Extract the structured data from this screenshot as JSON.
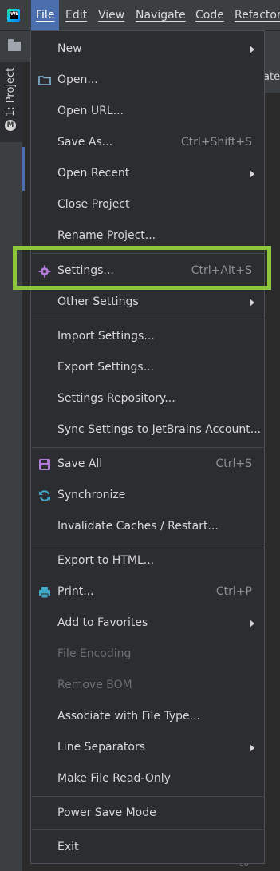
{
  "app": {
    "logo_text": "WS"
  },
  "menubar": {
    "file": "File",
    "edit": "Edit",
    "view": "View",
    "navigate": "Navigate",
    "code": "Code",
    "refactor": "Refactor"
  },
  "toolwindow": {
    "project_label": "1: Project",
    "maven_glyph": "M"
  },
  "background": {
    "tab_text": "ate",
    "line_number": "86"
  },
  "file_menu": {
    "new": "New",
    "open": "Open...",
    "open_url": "Open URL...",
    "save_as": "Save As...",
    "save_as_shortcut": "Ctrl+Shift+S",
    "open_recent": "Open Recent",
    "close_project": "Close Project",
    "rename_project": "Rename Project...",
    "settings": "Settings...",
    "settings_shortcut": "Ctrl+Alt+S",
    "other_settings": "Other Settings",
    "import_settings": "Import Settings...",
    "export_settings": "Export Settings...",
    "settings_repository": "Settings Repository...",
    "sync_settings": "Sync Settings to JetBrains Account...",
    "save_all": "Save All",
    "save_all_shortcut": "Ctrl+S",
    "synchronize": "Synchronize",
    "invalidate_caches": "Invalidate Caches / Restart...",
    "export_html": "Export to HTML...",
    "print": "Print...",
    "print_shortcut": "Ctrl+P",
    "add_favorites": "Add to Favorites",
    "file_encoding": "File Encoding",
    "remove_bom": "Remove BOM",
    "associate_file_type": "Associate with File Type...",
    "line_separators": "Line Separators",
    "make_read_only": "Make File Read-Only",
    "power_save": "Power Save Mode",
    "exit": "Exit"
  },
  "colors": {
    "highlight_box": "#8cc63f",
    "settings_icon": "#b07cd8",
    "sync_icon": "#3fa8c8",
    "print_icon": "#3fa8c8",
    "folder_icon": "#7fb8d6"
  }
}
